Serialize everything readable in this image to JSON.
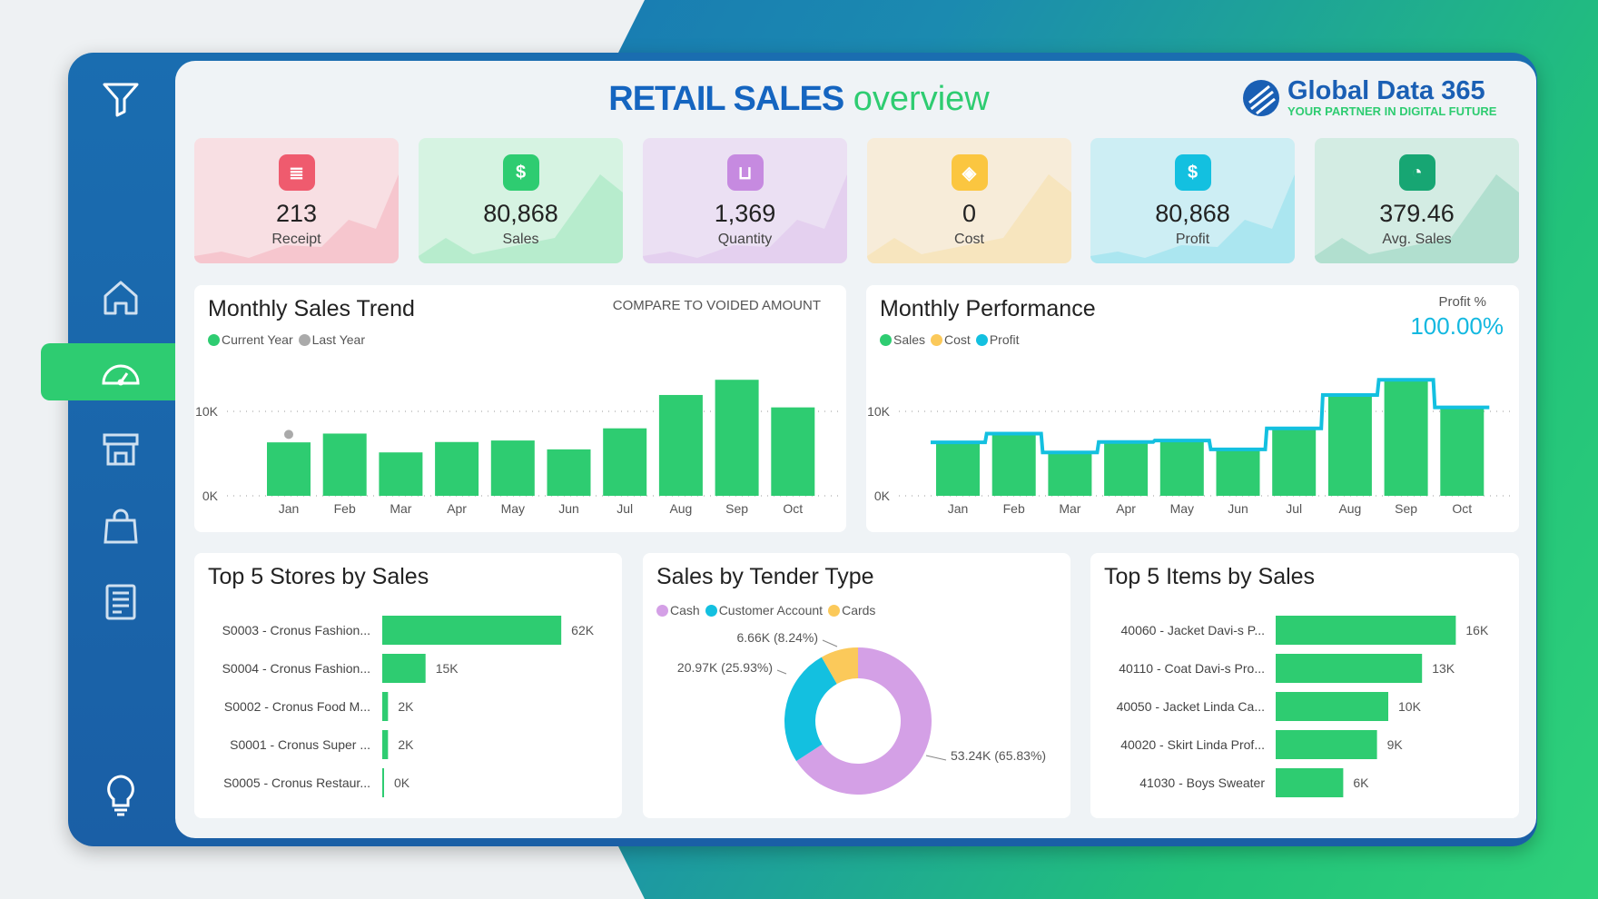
{
  "header": {
    "title_bold": "RETAIL SALES",
    "title_light": "overview"
  },
  "logo": {
    "name": "Global Data 365",
    "tagline": "YOUR PARTNER IN DIGITAL FUTURE"
  },
  "sidebar": {
    "items": [
      {
        "icon": "filter-icon"
      },
      {
        "icon": "home-icon"
      },
      {
        "icon": "dashboard-gauge-icon",
        "active": true
      },
      {
        "icon": "store-icon"
      },
      {
        "icon": "shopping-bag-icon"
      },
      {
        "icon": "report-icon"
      },
      {
        "icon": "lightbulb-icon"
      }
    ]
  },
  "kpis": [
    {
      "value": "213",
      "label": "Receipt",
      "color": "#ef5b6e",
      "bg": "#f8dfe3",
      "icon": "receipt-icon"
    },
    {
      "value": "80,868",
      "label": "Sales",
      "color": "#2ecc71",
      "bg": "#d6f3e2",
      "icon": "money-bag-icon"
    },
    {
      "value": "1,369",
      "label": "Quantity",
      "color": "#c68ae0",
      "bg": "#ebe0f3",
      "icon": "basket-icon"
    },
    {
      "value": "0",
      "label": "Cost",
      "color": "#fbc640",
      "bg": "#f7ecd9",
      "icon": "price-tag-icon"
    },
    {
      "value": "80,868",
      "label": "Profit",
      "color": "#13c0e0",
      "bg": "#cdeef4",
      "icon": "dollar-badge-icon"
    },
    {
      "value": "379.46",
      "label": "Avg. Sales",
      "color": "#17a673",
      "bg": "#d3ece3",
      "icon": "pie-icon"
    }
  ],
  "sales_trend": {
    "title": "Monthly Sales Trend",
    "link": "COMPARE TO VOIDED AMOUNT",
    "legend": [
      "Current Year",
      "Last Year"
    ]
  },
  "performance": {
    "title": "Monthly Performance",
    "legend": [
      "Sales",
      "Cost",
      "Profit"
    ],
    "profit_pct_label": "Profit %",
    "profit_pct": "100.00%"
  },
  "stores": {
    "title": "Top 5 Stores by Sales"
  },
  "tender": {
    "title": "Sales by Tender Type",
    "legend": [
      "Cash",
      "Customer Account",
      "Cards"
    ]
  },
  "items": {
    "title": "Top 5 Items by Sales"
  },
  "chart_data": [
    {
      "type": "bar",
      "title": "Monthly Sales Trend",
      "categories": [
        "Jan",
        "Feb",
        "Mar",
        "Apr",
        "May",
        "Jun",
        "Jul",
        "Aug",
        "Sep",
        "Oct"
      ],
      "series": [
        {
          "name": "Current Year",
          "values": [
            6.33,
            7.37,
            5.14,
            6.37,
            6.55,
            5.5,
            7.99,
            11.94,
            13.74,
            10.47
          ],
          "color": "#2ecc71"
        },
        {
          "name": "Last Year",
          "values": [
            7.27,
            null,
            null,
            null,
            null,
            null,
            null,
            null,
            null,
            null
          ],
          "color": "#aaaaaa"
        }
      ],
      "unit": "K",
      "yticks": [
        "0K",
        "10K"
      ],
      "ylim": [
        0,
        15
      ],
      "grid": true
    },
    {
      "type": "bar",
      "title": "Monthly Performance",
      "categories": [
        "Jan",
        "Feb",
        "Mar",
        "Apr",
        "May",
        "Jun",
        "Jul",
        "Aug",
        "Sep",
        "Oct"
      ],
      "series": [
        {
          "name": "Sales",
          "values": [
            6.33,
            7.37,
            5.14,
            6.37,
            6.55,
            5.5,
            7.99,
            11.94,
            13.74,
            10.47
          ],
          "color": "#2ecc71"
        },
        {
          "name": "Cost",
          "values": [
            0,
            0,
            0,
            0,
            0,
            0,
            0,
            0,
            0,
            0
          ],
          "color": "#fbc640"
        },
        {
          "name": "Profit",
          "values": [
            6.33,
            7.37,
            5.14,
            6.37,
            6.55,
            5.5,
            7.99,
            11.94,
            13.74,
            10.47
          ],
          "color": "#13c0e0"
        }
      ],
      "yticks": [
        "0K",
        "10K"
      ],
      "ylim": [
        0,
        15
      ]
    },
    {
      "type": "bar",
      "orientation": "horizontal",
      "title": "Top 5 Stores by Sales",
      "categories": [
        "S0003 - Cronus Fashion...",
        "S0004 - Cronus Fashion...",
        "S0002 - Cronus Food M...",
        "S0001 - Cronus Super ...",
        "S0005 - Cronus Restaur..."
      ],
      "values": [
        62,
        15,
        2,
        2,
        0
      ],
      "labels": [
        "62K",
        "15K",
        "2K",
        "2K",
        "0K"
      ]
    },
    {
      "type": "pie",
      "donut": true,
      "title": "Sales by Tender Type",
      "categories": [
        "Cash",
        "Customer Account",
        "Cards"
      ],
      "values": [
        53.24,
        20.97,
        6.66
      ],
      "percents": [
        65.83,
        25.93,
        8.24
      ],
      "labels": [
        "53.24K (65.83%)",
        "20.97K (25.93%)",
        "6.66K (8.24%)"
      ],
      "colors": [
        "#d4a0e6",
        "#13c0e0",
        "#fbc95a"
      ]
    },
    {
      "type": "bar",
      "orientation": "horizontal",
      "title": "Top 5 Items by Sales",
      "categories": [
        "40060 - Jacket Davi-s P...",
        "40110 - Coat Davi-s Pro...",
        "40050 - Jacket Linda Ca...",
        "40020 - Skirt Linda Prof...",
        "41030 - Boys Sweater"
      ],
      "values": [
        16,
        13,
        10,
        9,
        6
      ],
      "labels": [
        "16K",
        "13K",
        "10K",
        "9K",
        "6K"
      ]
    }
  ]
}
